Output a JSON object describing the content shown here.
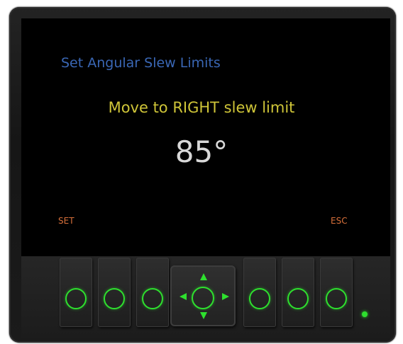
{
  "screen": {
    "title": "Set Angular Slew Limits",
    "instruction": "Move to RIGHT slew limit",
    "value": "85°"
  },
  "softkeys": {
    "left_label": "SET",
    "right_label": "ESC"
  },
  "keypad": {
    "buttons": [
      "button-1",
      "button-2",
      "button-3",
      "button-4",
      "button-5",
      "button-6"
    ]
  },
  "colors": {
    "title": "#3a67b5",
    "instruction": "#cfc538",
    "value": "#d8d8d8",
    "softkey_label": "#d8703a",
    "button_ring": "#2ee02e",
    "status_led": "#2ee02e"
  },
  "icons": {
    "buttons": "ring-icon",
    "dpad": [
      "arrow-up-icon",
      "arrow-down-icon",
      "arrow-left-icon",
      "arrow-right-icon"
    ],
    "led": "status-led-icon"
  }
}
